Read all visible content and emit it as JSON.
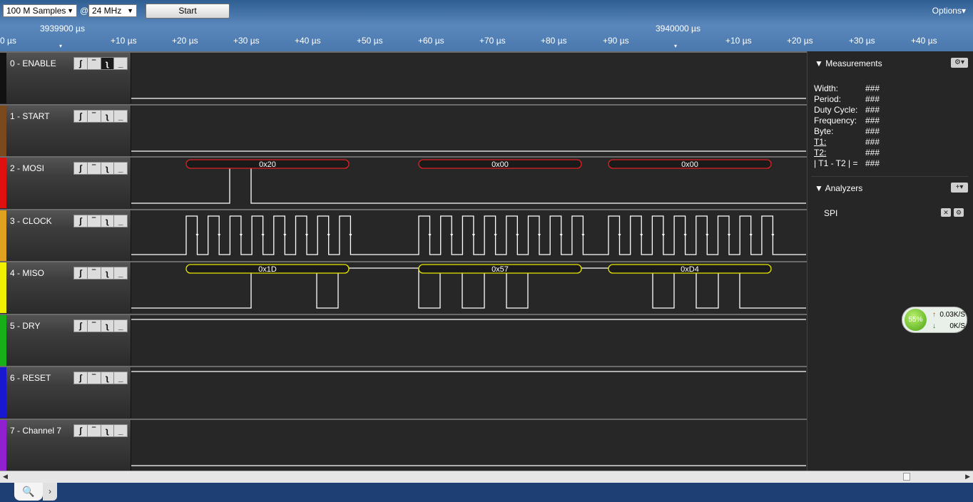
{
  "toolbar": {
    "samples_select": "100 M Samples",
    "at_sign": "@",
    "rate_select": "24 MHz",
    "start_label": "Start",
    "options_label": "Options▾"
  },
  "timeline": {
    "anchor_left": "3939900 µs",
    "anchor_right": "3940000 µs",
    "ticks": [
      "0 µs",
      "+10 µs",
      "+20 µs",
      "+30 µs",
      "+40 µs",
      "+50 µs",
      "+60 µs",
      "+70 µs",
      "+80 µs",
      "+90 µs",
      "+10 µs",
      "+20 µs",
      "+30 µs",
      "+40 µs"
    ]
  },
  "channels": [
    {
      "name": "0 - ENABLE",
      "color": "#111111"
    },
    {
      "name": "1 - START",
      "color": "#7a4a1e"
    },
    {
      "name": "2 - MOSI",
      "color": "#e01010"
    },
    {
      "name": "3 - CLOCK",
      "color": "#e0a020"
    },
    {
      "name": "4 - MISO",
      "color": "#f0f000"
    },
    {
      "name": "5 - DRY",
      "color": "#18b018"
    },
    {
      "name": "6 - RESET",
      "color": "#1818d0"
    },
    {
      "name": "7 - Channel 7",
      "color": "#9020d0"
    }
  ],
  "decoded": {
    "mosi": [
      "0x20",
      "0x00",
      "0x00"
    ],
    "miso": [
      "0x1D",
      "0x57",
      "0xD4"
    ]
  },
  "measurements": {
    "header": "Measurements",
    "rows": [
      {
        "label": "Width:",
        "value": "###"
      },
      {
        "label": "Period:",
        "value": "###"
      },
      {
        "label": "Duty Cycle:",
        "value": "###"
      },
      {
        "label": "Frequency:",
        "value": "###"
      },
      {
        "label": "Byte:",
        "value": "###"
      },
      {
        "label": "T1:",
        "value": "###"
      },
      {
        "label": "T2:",
        "value": "###"
      },
      {
        "label": "| T1 - T2 | =",
        "value": "###"
      }
    ]
  },
  "analyzers": {
    "header": "Analyzers",
    "items": [
      "SPI"
    ]
  },
  "cpu": {
    "percent": "55%",
    "up": "0.03K/S",
    "down": "0K/S"
  },
  "colors": {
    "mosi_frame": "#e02020",
    "miso_frame": "#e8e800",
    "wave": "#ffffff"
  }
}
